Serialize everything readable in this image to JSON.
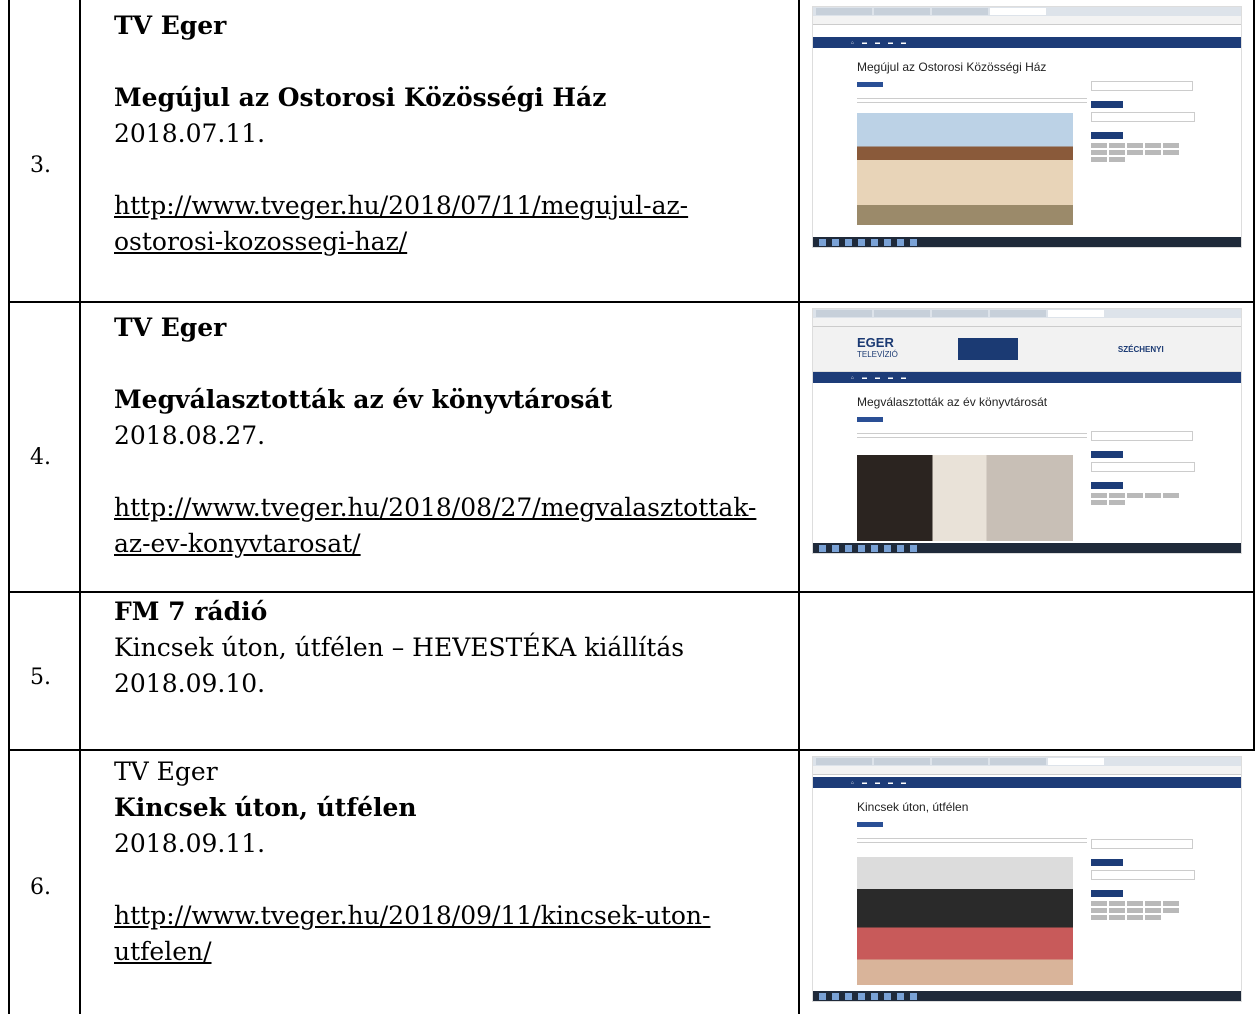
{
  "rows": [
    {
      "number": "3.",
      "source": "TV Eger",
      "title": "Megújul az Ostorosi Közösségi Ház",
      "date": "2018.07.11.",
      "link_line1": "http://www.tveger.hu/2018/07/11/megujul-az-",
      "link_line2": "ostorosi-kozossegi-haz/",
      "screenshot": {
        "page_heading": "Megújul az Ostorosi Közösségi Ház"
      }
    },
    {
      "number": "4.",
      "source": "TV Eger",
      "title": "Megválasztották az év könyvtárosát",
      "date": "2018.08.27.",
      "link_line1": "http://www.tveger.hu/2018/08/27/megvalasztottak-",
      "link_line2": "az-ev-konyvtarosat/",
      "screenshot": {
        "page_heading": "Megválasztották az év könyvtárosát",
        "logo_text": "EGER",
        "logo_sub": "TELEVÍZIÓ",
        "banner_right": "SZÉCHENYI"
      }
    },
    {
      "number": "5.",
      "source": "FM 7 rádió",
      "title": "Kincsek úton, útfélen – HEVESTÉKA kiállítás",
      "date": "2018.09.10."
    },
    {
      "number": "6.",
      "source": "TV Eger",
      "title": "Kincsek úton, útfélen",
      "date": "2018.09.11.",
      "link_line1": "http://www.tveger.hu/2018/09/11/kincsek-uton-",
      "link_line2": "utfelen/",
      "screenshot": {
        "page_heading": "Kincsek úton, útfélen"
      }
    }
  ],
  "colors": {
    "site_nav": "#1d3c78",
    "border": "#000000"
  }
}
